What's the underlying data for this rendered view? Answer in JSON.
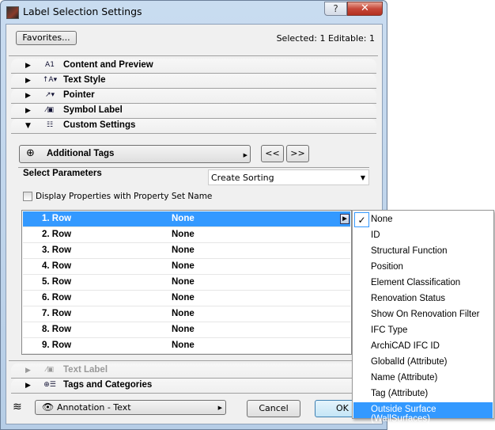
{
  "window": {
    "title": "Label Selection Settings",
    "help_label": "?",
    "close_label": "✕"
  },
  "header": {
    "favorites_label": "Favorites...",
    "selection_status": "Selected: 1 Editable: 1"
  },
  "sections": [
    {
      "label": "Content and Preview",
      "icon": "A1",
      "expanded": false
    },
    {
      "label": "Text Style",
      "icon": "↑A▾",
      "expanded": false
    },
    {
      "label": "Pointer",
      "icon": "↗▾",
      "expanded": false
    },
    {
      "label": "Symbol Label",
      "icon": "⁄▣",
      "expanded": false
    },
    {
      "label": "Custom Settings",
      "icon": "☷",
      "expanded": true
    }
  ],
  "custom": {
    "tags_button_label": "Additional Tags",
    "prev_label": "<<",
    "next_label": ">>",
    "select_parameters_label": "Select Parameters",
    "sorting_value": "Create Sorting",
    "display_properties_label": "Display Properties with Property Set Name",
    "display_properties_checked": false,
    "rows": [
      {
        "name": "1. Row",
        "value": "None",
        "selected": true
      },
      {
        "name": "2. Row",
        "value": "None"
      },
      {
        "name": "3. Row",
        "value": "None"
      },
      {
        "name": "4. Row",
        "value": "None"
      },
      {
        "name": "5. Row",
        "value": "None"
      },
      {
        "name": "6. Row",
        "value": "None"
      },
      {
        "name": "7. Row",
        "value": "None"
      },
      {
        "name": "8. Row",
        "value": "None"
      },
      {
        "name": "9. Row",
        "value": "None"
      }
    ]
  },
  "lower_sections": [
    {
      "label": "Text Label",
      "icon": "⁄▣",
      "enabled": false
    },
    {
      "label": "Tags and Categories",
      "icon": "⊕☰",
      "enabled": true
    }
  ],
  "footer": {
    "layer_value": "Annotation - Text",
    "cancel_label": "Cancel",
    "ok_label": "OK"
  },
  "menu": {
    "checked_index": 0,
    "highlighted_index": 12,
    "check_glyph": "✓",
    "items": [
      "None",
      "ID",
      "Structural Function",
      "Position",
      "Element Classification",
      "Renovation Status",
      "Show On Renovation Filter",
      "IFC Type",
      "ArchiCAD IFC ID",
      "GlobalId (Attribute)",
      "Name (Attribute)",
      "Tag (Attribute)",
      "Outside Surface (WallSurfaces)"
    ]
  },
  "colors": {
    "selection": "#3399ff"
  }
}
